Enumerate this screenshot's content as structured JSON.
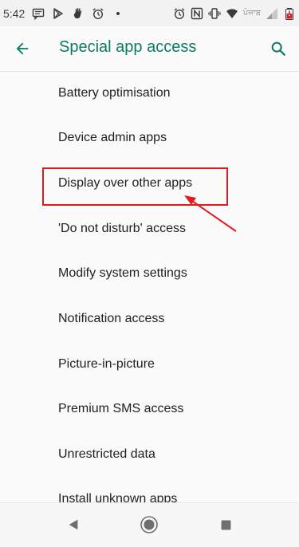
{
  "status_bar": {
    "time": "5:42",
    "network_text": "ਪੰਜਾਬ",
    "icons": [
      "message-icon",
      "play-store-icon",
      "hand-icon",
      "alarm-icon",
      "dot-icon",
      "alarm-icon",
      "nfc-icon",
      "vibrate-icon",
      "wifi-icon",
      "signal-icon",
      "battery-icon"
    ]
  },
  "app_bar": {
    "title": "Special app access",
    "back_icon": "arrow-back-icon",
    "search_icon": "search-icon"
  },
  "settings_list": [
    {
      "label": "Battery optimisation"
    },
    {
      "label": "Device admin apps"
    },
    {
      "label": "Display over other apps"
    },
    {
      "label": "'Do not disturb' access"
    },
    {
      "label": "Modify system settings"
    },
    {
      "label": "Notification access"
    },
    {
      "label": "Picture-in-picture"
    },
    {
      "label": "Premium SMS access"
    },
    {
      "label": "Unrestricted data"
    },
    {
      "label": "Install unknown apps"
    }
  ],
  "annotation": {
    "highlight_color": "#e01b1b",
    "highlighted_item": "Display over other apps"
  },
  "nav_bar": {
    "icons": [
      "back-triangle-icon",
      "home-circle-icon",
      "recents-square-icon"
    ]
  },
  "colors": {
    "accent": "#0b7a63",
    "background": "#fafafa",
    "annotation": "#e01b1b"
  }
}
